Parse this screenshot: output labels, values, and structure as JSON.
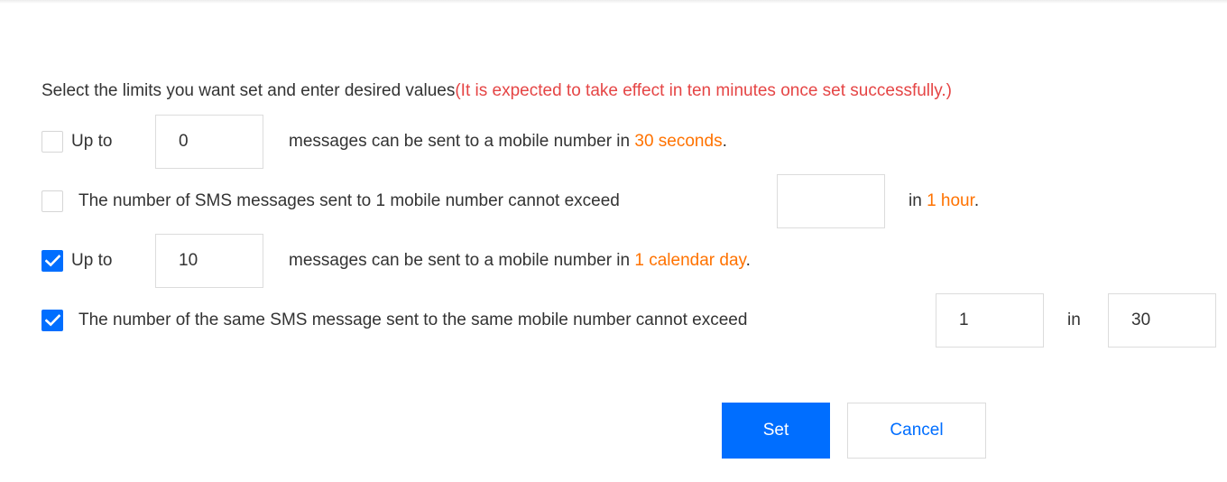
{
  "instruction": {
    "text": "Select the limits you want set and enter desired values",
    "note": "(It is expected to take effect in ten minutes once set successfully.)"
  },
  "rules": [
    {
      "checked": false,
      "prefix": "Up to",
      "value": "0",
      "suffix": "messages can be sent to a mobile number in ",
      "period": "30 seconds",
      "end": "."
    },
    {
      "checked": false,
      "prefix": "The number of SMS messages sent to 1 mobile number cannot exceed",
      "value": "",
      "suffix": "in ",
      "period": "1 hour",
      "end": "."
    },
    {
      "checked": true,
      "prefix": "Up to",
      "value": "10",
      "suffix": "messages can be sent to a mobile number in ",
      "period": "1 calendar day",
      "end": "."
    },
    {
      "checked": true,
      "prefix": "The number of the same SMS message sent to the same mobile number cannot exceed",
      "value": "1",
      "middle": "in",
      "value2": "30"
    }
  ],
  "actions": {
    "set_label": "Set",
    "cancel_label": "Cancel"
  },
  "colors": {
    "primary": "#006eff",
    "highlight": "#ff7200",
    "note": "#e54545"
  },
  "icons": {
    "checkmark": "checkmark-icon"
  }
}
